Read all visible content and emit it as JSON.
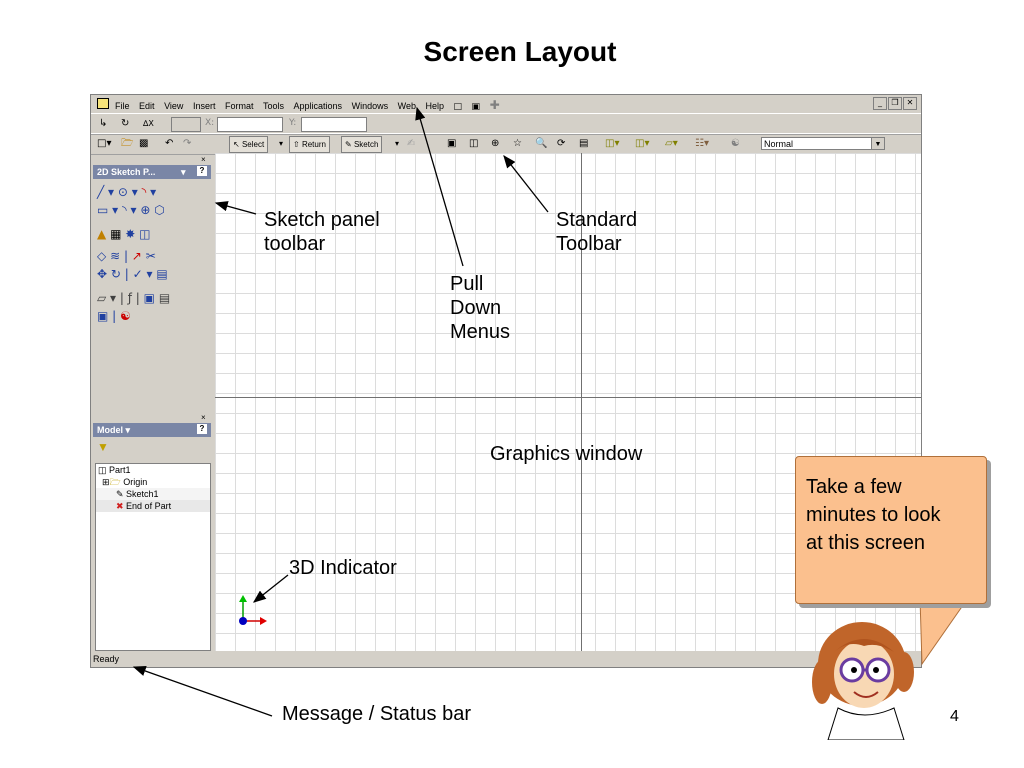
{
  "slide": {
    "title": "Screen Layout",
    "page_number": "4"
  },
  "app": {
    "menu": [
      "File",
      "Edit",
      "View",
      "Insert",
      "Format",
      "Tools",
      "Applications",
      "Windows",
      "Web",
      "Help"
    ],
    "coords": {
      "x_label": "X:",
      "y_label": "Y:"
    },
    "toolbar": {
      "select_label": "Select",
      "return_label": "Return",
      "sketch_label": "Sketch",
      "style_value": "Normal"
    },
    "sketch_panel": {
      "header": "2D Sketch P..."
    },
    "browser": {
      "header": "Model",
      "tree": [
        "Part1",
        "Origin",
        "Sketch1",
        "End of Part"
      ]
    },
    "status": "Ready"
  },
  "annotations": {
    "sketch_panel": [
      "Sketch panel",
      "toolbar"
    ],
    "standard_toolbar": [
      "Standard",
      "Toolbar"
    ],
    "pull_down": [
      "Pull",
      "Down",
      "Menus"
    ],
    "graphics_window": "Graphics window",
    "indicator_3d": "3D Indicator",
    "status_bar": "Message / Status bar"
  },
  "callout": {
    "lines": [
      "Take a few",
      "minutes to look",
      "at this screen"
    ]
  },
  "colors": {
    "callout_fill": "#fbc08e",
    "panel_header": "#7a86a6",
    "window_gray": "#d4d0c8"
  }
}
